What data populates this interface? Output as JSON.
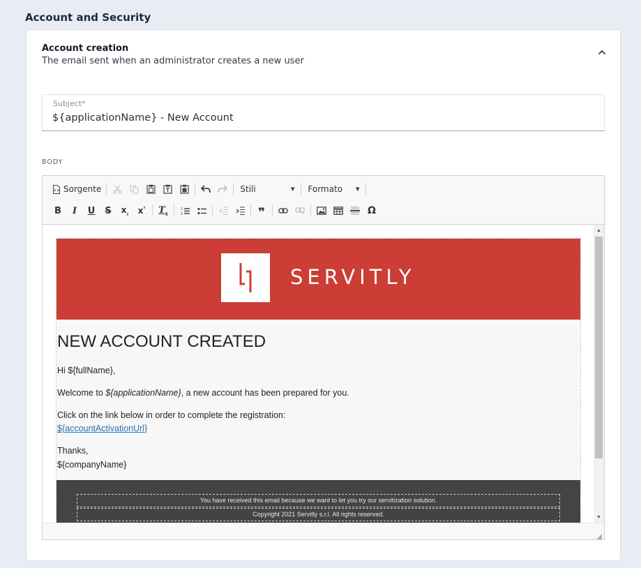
{
  "section": {
    "title": "Account and Security"
  },
  "card": {
    "title": "Account creation",
    "subtitle": "The email sent when an administrator creates a new user"
  },
  "subject": {
    "label": "Subject*",
    "value": "${applicationName} - New Account"
  },
  "body": {
    "label": "BODY"
  },
  "toolbar": {
    "source_label": "Sorgente",
    "styles_label": "Stili",
    "format_label": "Formato",
    "icons": [
      "source-icon",
      "cut-icon",
      "copy-icon",
      "paste-icon",
      "paste-text-icon",
      "paste-word-icon",
      "undo-icon",
      "redo-icon",
      "bold-icon",
      "italic-icon",
      "underline-icon",
      "strikethrough-icon",
      "subscript-icon",
      "superscript-icon",
      "remove-format-icon",
      "numbered-list-icon",
      "bulleted-list-icon",
      "outdent-icon",
      "indent-icon",
      "blockquote-icon",
      "link-icon",
      "unlink-icon",
      "image-icon",
      "table-icon",
      "horizontal-line-icon",
      "special-char-icon"
    ]
  },
  "email": {
    "brand": "SERVITLY",
    "heading": "NEW ACCOUNT CREATED",
    "greeting": "Hi ${fullName},",
    "welcome_prefix": "Welcome to ",
    "welcome_app": "${applicationName}",
    "welcome_suffix": ", a new account has been prepared for you.",
    "instructions": "Click on the link below in order to complete the registration:",
    "link": "${accountActivationUrl}",
    "thanks": "Thanks,",
    "signature": "${companyName}",
    "footer_line1": "You have received this email because we want to let you try our servitization solution.",
    "footer_line2": "Copyright 2021 Servitly s.r.l. All rights reserved."
  },
  "colors": {
    "banner": "#cc3d35",
    "footer": "#444444",
    "link": "#2a6fb5",
    "page_bg": "#e8edf3"
  }
}
